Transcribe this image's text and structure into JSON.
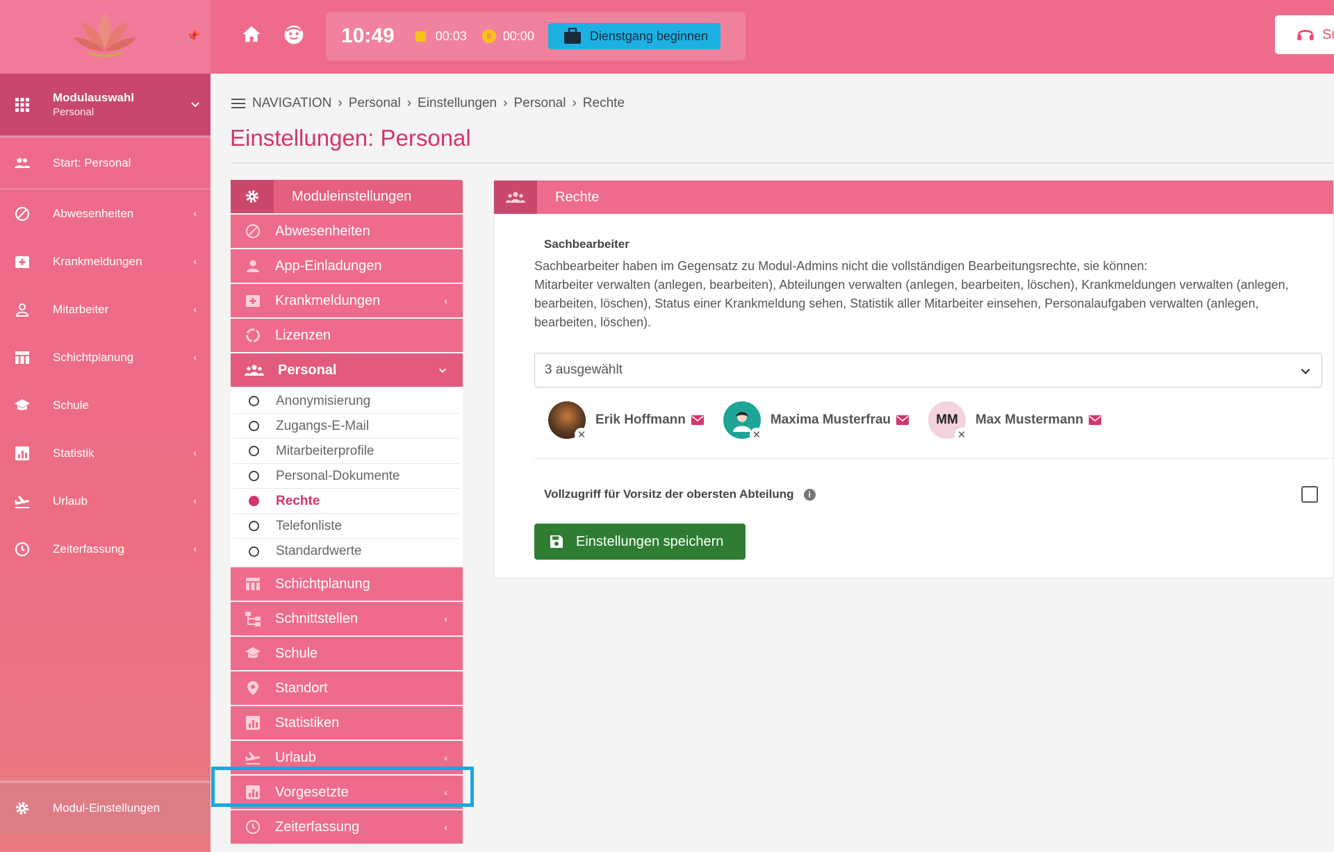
{
  "sidebar": {
    "module": {
      "title": "Modulauswahl",
      "subtitle": "Personal"
    },
    "start": "Start: Personal",
    "items": [
      {
        "label": "Abwesenheiten",
        "icon": "block-icon"
      },
      {
        "label": "Krankmeldungen",
        "icon": "medical-icon"
      },
      {
        "label": "Mitarbeiter",
        "icon": "person-icon"
      },
      {
        "label": "Schichtplanung",
        "icon": "calendar-icon"
      },
      {
        "label": "Schule",
        "icon": "school-icon"
      },
      {
        "label": "Statistik",
        "icon": "chart-icon"
      },
      {
        "label": "Urlaub",
        "icon": "plane-icon"
      },
      {
        "label": "Zeiterfassung",
        "icon": "clock-icon"
      }
    ],
    "bottom": "Modul-Einstellungen"
  },
  "header": {
    "time": "10:49",
    "work_timer": "00:03",
    "pause_timer": "00:00",
    "duty_button": "Dienstgang beginnen",
    "support_button": "Su"
  },
  "breadcrumb": [
    "NAVIGATION",
    "Personal",
    "Einstellungen",
    "Personal",
    "Rechte"
  ],
  "page_title": "Einstellungen: Personal",
  "settings_menu": {
    "header": "Moduleinstellungen",
    "items_top": [
      {
        "label": "Abwesenheiten",
        "expandable": false
      },
      {
        "label": "App-Einladungen",
        "expandable": false
      },
      {
        "label": "Krankmeldungen",
        "expandable": true
      },
      {
        "label": "Lizenzen",
        "expandable": false
      }
    ],
    "active_item": "Personal",
    "subitems": [
      "Anonymisierung",
      "Zugangs-E-Mail",
      "Mitarbeiterprofile",
      "Personal-Dokumente",
      "Rechte",
      "Telefonliste",
      "Standardwerte"
    ],
    "selected_subitem": "Rechte",
    "items_bottom": [
      {
        "label": "Schichtplanung",
        "expandable": false
      },
      {
        "label": "Schnittstellen",
        "expandable": true
      },
      {
        "label": "Schule",
        "expandable": false
      },
      {
        "label": "Standort",
        "expandable": false
      },
      {
        "label": "Statistiken",
        "expandable": false
      },
      {
        "label": "Urlaub",
        "expandable": true
      },
      {
        "label": "Vorgesetzte",
        "expandable": true
      },
      {
        "label": "Zeiterfassung",
        "expandable": true
      }
    ]
  },
  "panel": {
    "title": "Rechte",
    "section_label": "Sachbearbeiter",
    "description_line1": "Sachbearbeiter haben im Gegensatz zu Modul-Admins nicht die vollständigen Bearbeitungsrechte, sie können:",
    "description_line2": "Mitarbeiter verwalten (anlegen, bearbeiten), Abteilungen verwalten (anlegen, bearbeiten, löschen), Krankmeldungen verwalten (anlegen, bearbeiten, löschen), Status einer Krankmeldung sehen, Statistik aller Mitarbeiter einsehen, Personalaufgaben verwalten (anlegen, bearbeiten, löschen).",
    "select_value": "3 ausgewählt",
    "selected_users": [
      {
        "name": "Erik Hoffmann",
        "initials": "",
        "avatar_color": "#5a3a22"
      },
      {
        "name": "Maxima Musterfrau",
        "initials": "",
        "avatar_color": "#1ea597"
      },
      {
        "name": "Max Mustermann",
        "initials": "MM",
        "avatar_color": "#f3d3dc"
      }
    ],
    "full_access_label": "Vollzugriff für Vorsitz der obersten Abteilung",
    "full_access_checked": false,
    "save_button": "Einstellungen speichern"
  },
  "colors": {
    "primary": "#ef6b8b",
    "primary_dark": "#c9486b",
    "title": "#d6336c",
    "save": "#2e7d32",
    "duty": "#1db1e3",
    "highlight": "#19a7e0"
  }
}
